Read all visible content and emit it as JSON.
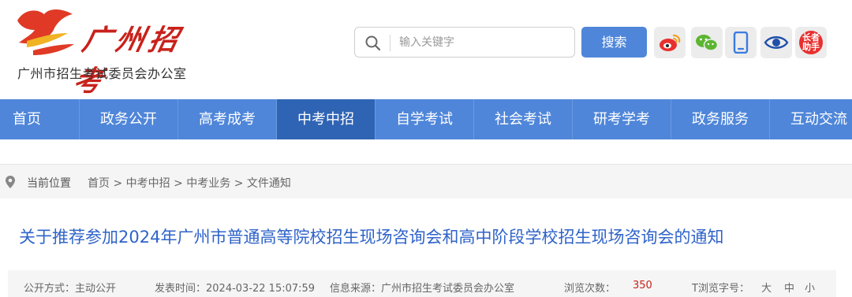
{
  "header": {
    "logo_script": "广州招考",
    "logo_sub": "广州市招生考试委员会办公室",
    "search": {
      "placeholder": "输入关键字"
    },
    "search_button": "搜索",
    "badge_text": "长者助手"
  },
  "nav": {
    "items": [
      "首页",
      "政务公开",
      "高考成考",
      "中考中招",
      "自学考试",
      "社会考试",
      "研考学考",
      "政务服务",
      "互动交流"
    ],
    "active": "中考中招"
  },
  "breadcrumb": {
    "label": "当前位置",
    "path": "首页 > 中考中招 > 中考业务 > 文件通知"
  },
  "article": {
    "title": "关于推荐参加2024年广州市普通高等院校招生现场咨询会和高中阶段学校招生现场咨询会的通知",
    "meta": {
      "public_mode": "公开方式：主动公开",
      "publish_time": "发表时间：2024-03-22 15:07:59",
      "source": "信息来源：广州市招生考试委员会办公室",
      "views_label": "浏览次数：",
      "views": "350",
      "font_size": "T浏览字号：",
      "font_big": "大",
      "font_mid": "中",
      "font_small": "小"
    }
  },
  "colors": {
    "primary": "#4f86d9",
    "nav_active": "#2f64b4",
    "brand_red": "#c8221b",
    "title_blue": "#2f63c9"
  },
  "icons": [
    "search-icon",
    "weibo-icon",
    "wechat-icon",
    "mobile-icon",
    "eye-icon",
    "location-pin-icon",
    "logo-mark"
  ]
}
